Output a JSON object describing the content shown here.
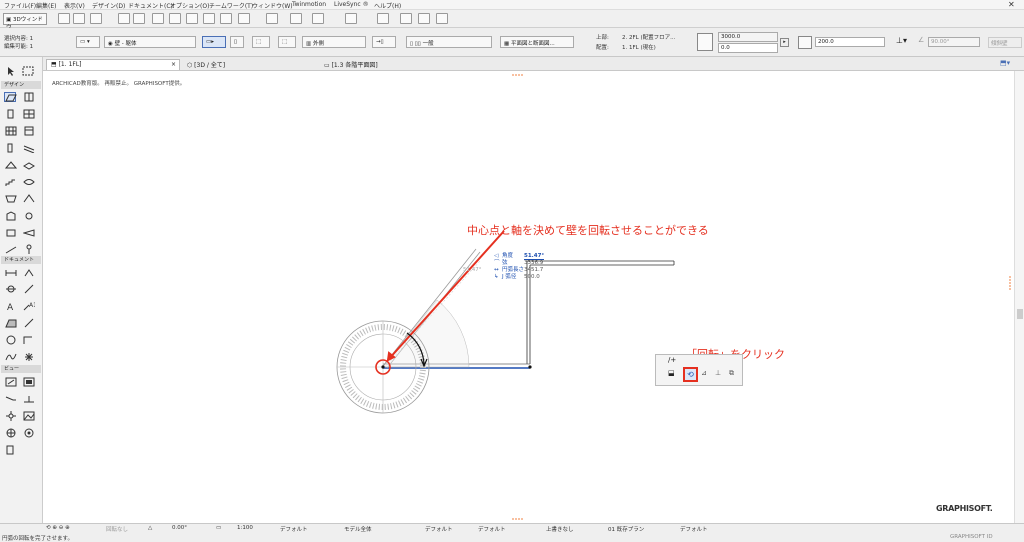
{
  "menu": {
    "items": [
      "ファイル(F)",
      "編集(E)",
      "表示(V)",
      "デザイン(D)",
      "ドキュメント(C)",
      "オプション(O)",
      "チームワーク(T)",
      "ウィンドウ(W)",
      "Twinmotion",
      "LiveSync ®",
      "ヘルプ(H)"
    ]
  },
  "toolbar": {
    "window3d_label": "3Dウィンドウ"
  },
  "infobox": {
    "selected_label": "選択内容: 1",
    "edited_label": "編集可能: 1",
    "layer_value": "壁 - 躯体",
    "exterior_value": "外側",
    "general_value": "一般",
    "floorplan_value": "平面図と断面図...",
    "top_label": "上部:",
    "top_value": "2. 2FL (配置フロア...",
    "placement_label": "配置:",
    "placement_value": "1. 1FL (現在)",
    "height_value": "3000.0",
    "offset_value": "0.0",
    "thickness_value": "200.0",
    "angle_value": "90.00°",
    "slant_label": "傾斜壁"
  },
  "tabs": [
    {
      "label": "[1. 1FL]"
    },
    {
      "label": "[3D / 全て]"
    },
    {
      "label": "[1.3 各階平面図]"
    }
  ],
  "toolbox": {
    "design_header": "デザイン",
    "document_header": "ドキュメント",
    "view_header": "ビュー"
  },
  "canvas": {
    "credit": "ARCHICAD教育版。 再販禁止。 GRAPHISOFT提供。",
    "annotation_rotate_axis": "中心点と軸を決めて壁を回転させることができる",
    "annotation_click_rotate": "「回転」をクリック",
    "angle_ghost": "51.47°",
    "coords": [
      {
        "icon": "◁",
        "label": "角度",
        "value": "51.47°"
      },
      {
        "icon": "⌒",
        "label": "弦",
        "value": "3336.9"
      },
      {
        "icon": "↔",
        "label": "円弧長さ",
        "value": "3451.7"
      },
      {
        "icon": "↳",
        "label": "J 弧径",
        "value": "500.0"
      }
    ],
    "logo": "GRAPHISOFT."
  },
  "statusbar": {
    "status_text": "円弧の回転を完了させます。",
    "no_undo": "回転なし",
    "angle": "0.00°",
    "scale": "1:100",
    "default1": "デフォルト",
    "model_all": "モデル全体",
    "default2": "デフォルト",
    "default3": "デフォルト",
    "override": "上書きなし",
    "plan": "01 既存プラン",
    "default4": "デフォルト",
    "graphisoft_id": "GRAPHISOFT ID"
  },
  "colors": {
    "annotation_red": "#e53020",
    "selection_blue": "#1d4fb0"
  }
}
